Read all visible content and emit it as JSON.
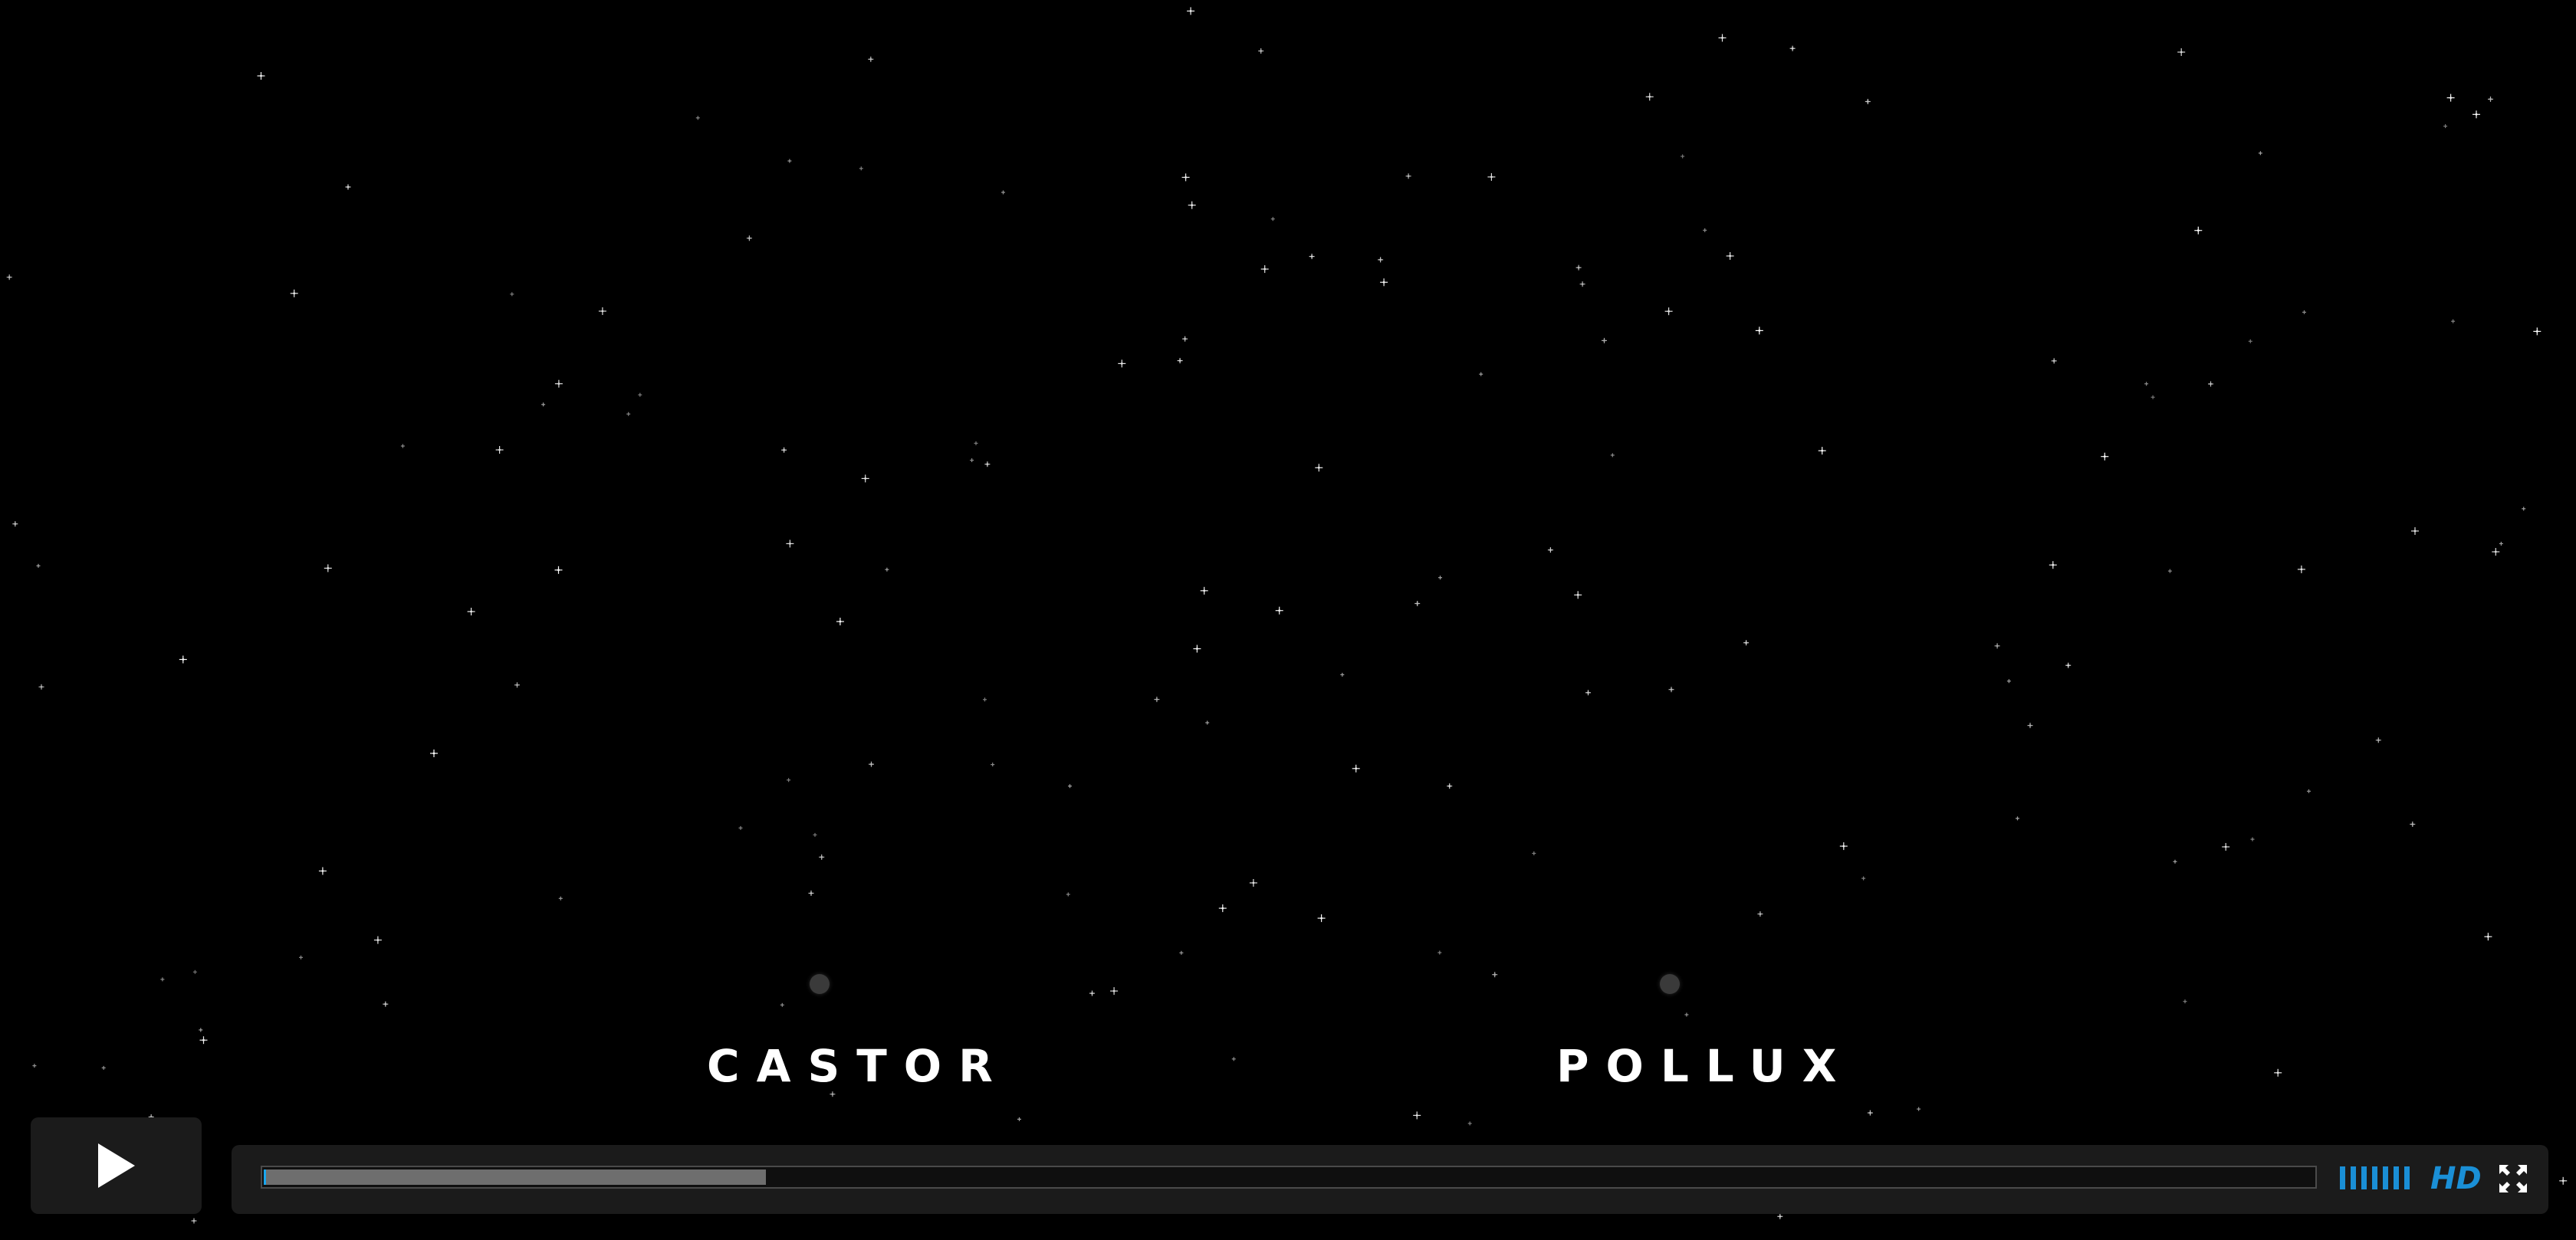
{
  "scene": {
    "stars": [
      {
        "name": "Castor",
        "label": "CASTOR"
      },
      {
        "name": "Pollux",
        "label": "POLLUX"
      }
    ]
  },
  "player": {
    "play_icon": "play-icon",
    "progress": {
      "played_fraction": 0.001,
      "buffered_fraction": 0.245
    },
    "volume": {
      "level_fraction": 1.0,
      "bars": 7,
      "icon": "volume-bars-icon"
    },
    "hd_label": "HD",
    "fullscreen_icon": "fullscreen-icon",
    "accent_color": "#1a8fd6"
  }
}
